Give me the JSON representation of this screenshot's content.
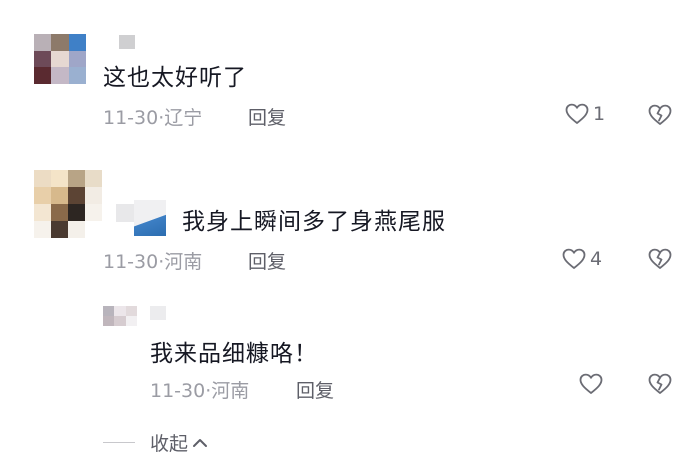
{
  "comments": [
    {
      "text": "这也太好听了",
      "date_location": "11-30·辽宁",
      "reply_label": "回复",
      "like_count": "1",
      "avatar_colors": [
        "#b9b0b6",
        "#8d7a6a",
        "#3f80c7",
        "#6d4a58",
        "#e6d8d2",
        "#9fa6c8",
        "#5a2a30",
        "#c4b8c6",
        "#9ab0d0"
      ]
    },
    {
      "text": "我身上瞬间多了身燕尾服",
      "date_location": "11-30·河南",
      "reply_label": "回复",
      "like_count": "4",
      "avatar_colors": [
        "#ecdcc4",
        "#f4e4c8",
        "#b8a486",
        "#e8dcc8",
        "#e8cfa9",
        "#d7b98c",
        "#5c4434",
        "#f2ece4",
        "#f3e6d2",
        "#8a6a4a",
        "#2d2622",
        "#f6f2ec",
        "#f6f2ec",
        "#4a3a30",
        "#f4f0ea",
        "#ffffff"
      ]
    }
  ],
  "reply": {
    "text": "我来品细糠咯！",
    "date_location": "11-30·河南",
    "reply_label": "回复",
    "avatar_colors": [
      "#b8b4bc",
      "#ece6ea",
      "#e2dadc",
      "#c0b6bc",
      "#d6ccd0",
      "#f2f0f2"
    ]
  },
  "collapse_label": "收起",
  "icons": {
    "like": "heart-outline-icon",
    "dislike": "broken-heart-icon",
    "collapse": "chevron-up-icon"
  }
}
